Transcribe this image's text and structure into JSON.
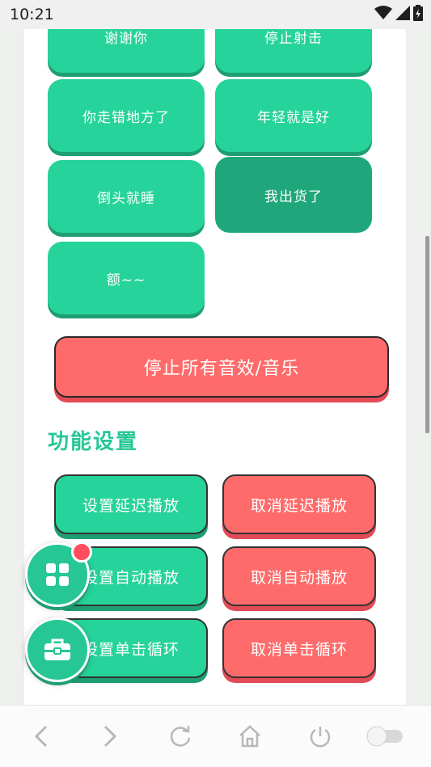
{
  "status_bar": {
    "time": "10:21"
  },
  "sound_buttons": [
    {
      "label": "谢谢你"
    },
    {
      "label": "停止射击"
    },
    {
      "label": "你走错地方了"
    },
    {
      "label": "年轻就是好"
    },
    {
      "label": "倒头就睡"
    },
    {
      "label": "我出货了",
      "state": "active"
    },
    {
      "label": "额~~"
    }
  ],
  "stop_all": {
    "label": "停止所有音效/音乐"
  },
  "section": {
    "title": "功能设置"
  },
  "function_buttons": [
    {
      "label": "设置延迟播放",
      "color": "#26d39a"
    },
    {
      "label": "取消延迟播放",
      "color": "#ff6b6b"
    },
    {
      "label": "设置自动播放",
      "color": "#26d39a"
    },
    {
      "label": "取消自动播放",
      "color": "#ff6b6b"
    },
    {
      "label": "设置单击循环",
      "color": "#26d39a"
    },
    {
      "label": "取消单击循环",
      "color": "#ff6b6b"
    }
  ],
  "fabs": [
    {
      "icon": "grid-icon",
      "has_badge": true
    },
    {
      "icon": "toolbox-icon",
      "has_badge": false
    }
  ],
  "bottom_nav": {
    "icons": [
      "back-icon",
      "forward-icon",
      "refresh-icon",
      "home-icon",
      "power-icon",
      "toggle-icon"
    ]
  },
  "colors": {
    "green": "#26d39a",
    "green_dark": "#1fa77b",
    "red": "#ff6b6b",
    "title_green": "#26c795",
    "badge": "#ff4f5e"
  }
}
